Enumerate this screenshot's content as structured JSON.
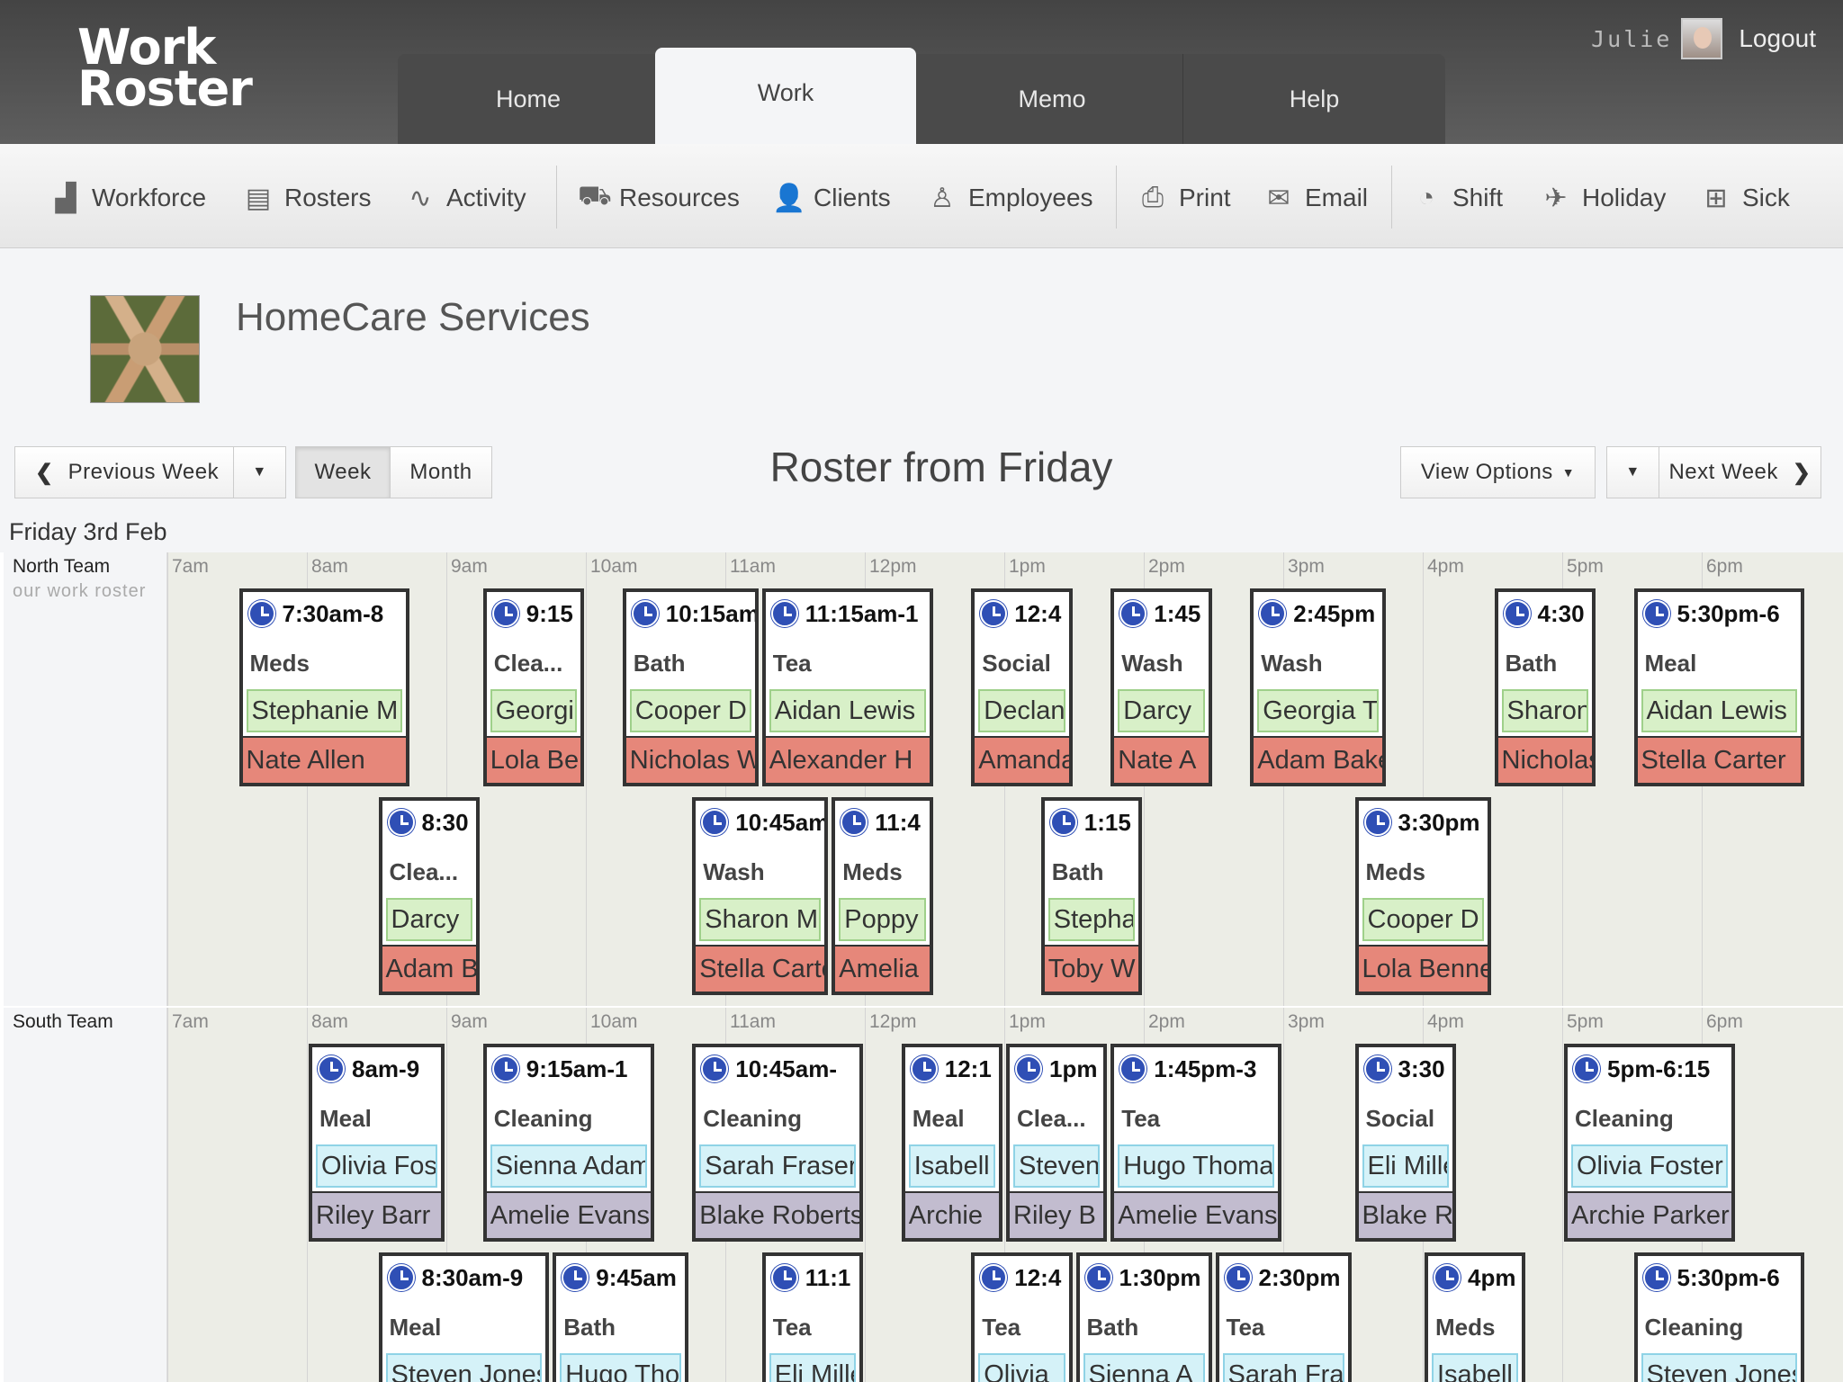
{
  "app": {
    "logo_line1": "Work",
    "logo_line2": "Roster"
  },
  "nav": {
    "tabs": [
      "Home",
      "Work",
      "Memo",
      "Help"
    ],
    "active": "Work"
  },
  "user": {
    "name": "Julie",
    "logout": "Logout"
  },
  "toolbar": {
    "workforce": "Workforce",
    "rosters": "Rosters",
    "activity": "Activity",
    "resources": "Resources",
    "clients": "Clients",
    "employees": "Employees",
    "print": "Print",
    "email": "Email",
    "shift": "Shift",
    "holiday": "Holiday",
    "sick": "Sick"
  },
  "organisation": {
    "name": "HomeCare Services"
  },
  "controls": {
    "previous_week": "Previous Week",
    "week": "Week",
    "month": "Month",
    "title": "Roster from Friday",
    "view_options": "View Options",
    "next_week": "Next Week"
  },
  "day": {
    "label": "Friday 3rd Feb"
  },
  "hours": [
    "7am",
    "8am",
    "9am",
    "10am",
    "11am",
    "12pm",
    "1pm",
    "2pm",
    "3pm",
    "4pm",
    "5pm",
    "6pm"
  ],
  "teams": [
    {
      "name": "North Team",
      "subtitle": "our work roster",
      "shifts": [
        {
          "time": "7:30am-8",
          "activity": "Meds",
          "client": "Stephanie M",
          "employee": "Nate Allen",
          "start": 7.5,
          "dur": 1.25,
          "row": 0
        },
        {
          "time": "8:30",
          "activity": "Clea...",
          "client": "Darcy",
          "employee": "Adam B",
          "start": 8.5,
          "dur": 0.75,
          "row": 1
        },
        {
          "time": "9:15",
          "activity": "Clea...",
          "client": "Georgia",
          "employee": "Lola Bennett",
          "start": 9.25,
          "dur": 0.75,
          "row": 0
        },
        {
          "time": "10:15am",
          "activity": "Bath",
          "client": "Cooper D",
          "employee": "Nicholas W",
          "start": 10.25,
          "dur": 1.0,
          "row": 0
        },
        {
          "time": "10:45am",
          "activity": "Wash",
          "client": "Sharon M",
          "employee": "Stella Carter",
          "start": 10.75,
          "dur": 1.0,
          "row": 1
        },
        {
          "time": "11:15am-1",
          "activity": "Tea",
          "client": "Aidan Lewis",
          "employee": "Alexander H",
          "start": 11.25,
          "dur": 1.25,
          "row": 0
        },
        {
          "time": "11:4",
          "activity": "Meds",
          "client": "Poppy",
          "employee": "Amelia",
          "start": 11.75,
          "dur": 0.75,
          "row": 1
        },
        {
          "time": "12:4",
          "activity": "Social",
          "client": "Declan",
          "employee": "Amanda",
          "start": 12.75,
          "dur": 0.75,
          "row": 0
        },
        {
          "time": "1:15",
          "activity": "Bath",
          "client": "Stephanie",
          "employee": "Toby W",
          "start": 13.25,
          "dur": 0.75,
          "row": 1
        },
        {
          "time": "1:45",
          "activity": "Wash",
          "client": "Darcy",
          "employee": "Nate A",
          "start": 13.75,
          "dur": 0.75,
          "row": 0
        },
        {
          "time": "2:45pm",
          "activity": "Wash",
          "client": "Georgia T",
          "employee": "Adam Baker",
          "start": 14.75,
          "dur": 1.0,
          "row": 0
        },
        {
          "time": "3:30pm",
          "activity": "Meds",
          "client": "Cooper D",
          "employee": "Lola Bennett",
          "start": 15.5,
          "dur": 1.0,
          "row": 1
        },
        {
          "time": "4:30",
          "activity": "Bath",
          "client": "Sharon",
          "employee": "Nicholas",
          "start": 16.5,
          "dur": 0.75,
          "row": 0
        },
        {
          "time": "5:30pm-6",
          "activity": "Meal",
          "client": "Aidan Lewis",
          "employee": "Stella Carter",
          "start": 17.5,
          "dur": 1.25,
          "row": 0
        }
      ]
    },
    {
      "name": "South Team",
      "subtitle": "",
      "shifts": [
        {
          "time": "8am-9",
          "activity": "Meal",
          "client": "Olivia Foster",
          "employee": "Riley Barr",
          "start": 8.0,
          "dur": 1.0,
          "row": 0
        },
        {
          "time": "8:30am-9",
          "activity": "Meal",
          "client": "Steven Jones",
          "employee": "",
          "start": 8.5,
          "dur": 1.25,
          "row": 1
        },
        {
          "time": "9:15am-1",
          "activity": "Cleaning",
          "client": "Sienna Adams",
          "employee": "Amelie Evans",
          "start": 9.25,
          "dur": 1.25,
          "row": 0
        },
        {
          "time": "9:45am",
          "activity": "Bath",
          "client": "Hugo Thomas",
          "employee": "",
          "start": 9.75,
          "dur": 1.0,
          "row": 1
        },
        {
          "time": "10:45am-",
          "activity": "Cleaning",
          "client": "Sarah Fraser",
          "employee": "Blake Roberts",
          "start": 10.75,
          "dur": 1.25,
          "row": 0
        },
        {
          "time": "11:1",
          "activity": "Tea",
          "client": "Eli Miller",
          "employee": "",
          "start": 11.25,
          "dur": 0.75,
          "row": 1
        },
        {
          "time": "12:1",
          "activity": "Meal",
          "client": "Isabell",
          "employee": "Archie",
          "start": 12.25,
          "dur": 0.75,
          "row": 0
        },
        {
          "time": "12:4",
          "activity": "Tea",
          "client": "Olivia",
          "employee": "",
          "start": 12.75,
          "dur": 0.75,
          "row": 1
        },
        {
          "time": "1pm",
          "activity": "Clea...",
          "client": "Steven",
          "employee": "Riley B",
          "start": 13.0,
          "dur": 0.75,
          "row": 0
        },
        {
          "time": "1:30pm",
          "activity": "Bath",
          "client": "Sienna A",
          "employee": "",
          "start": 13.5,
          "dur": 1.0,
          "row": 1
        },
        {
          "time": "1:45pm-3",
          "activity": "Tea",
          "client": "Hugo Thomas",
          "employee": "Amelie Evans",
          "start": 13.75,
          "dur": 1.25,
          "row": 0
        },
        {
          "time": "2:30pm",
          "activity": "Tea",
          "client": "Sarah Fraser",
          "employee": "",
          "start": 14.5,
          "dur": 1.0,
          "row": 1
        },
        {
          "time": "3:30",
          "activity": "Social",
          "client": "Eli Miller",
          "employee": "Blake R",
          "start": 15.5,
          "dur": 0.75,
          "row": 0
        },
        {
          "time": "4pm",
          "activity": "Meds",
          "client": "Isabell",
          "employee": "",
          "start": 16.0,
          "dur": 0.75,
          "row": 1
        },
        {
          "time": "5pm-6:15",
          "activity": "Cleaning",
          "client": "Olivia Foster",
          "employee": "Archie Parker",
          "start": 17.0,
          "dur": 1.25,
          "row": 0
        },
        {
          "time": "5:30pm-6",
          "activity": "Cleaning",
          "client": "Steven Jones",
          "employee": "",
          "start": 17.5,
          "dur": 1.25,
          "row": 1
        }
      ]
    }
  ]
}
